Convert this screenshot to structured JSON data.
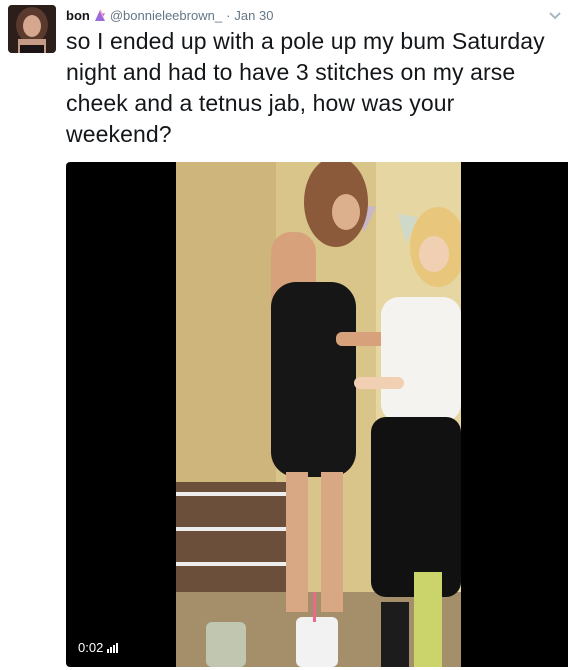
{
  "tweet": {
    "name": "bon",
    "handle": "@bonnieleebrown_",
    "separator": "·",
    "date": "Jan 30",
    "text": "so I ended up with a pole up my bum Saturday night and had to have 3 stitches on my arse cheek and a tetnus jab, how was your weekend?"
  },
  "video": {
    "time": "0:02",
    "volume_icon": "volume-bars-icon"
  },
  "colors": {
    "text": "#14171a",
    "muted": "#657786",
    "badge": "#9b6bdc",
    "video_bg": "#000000"
  }
}
